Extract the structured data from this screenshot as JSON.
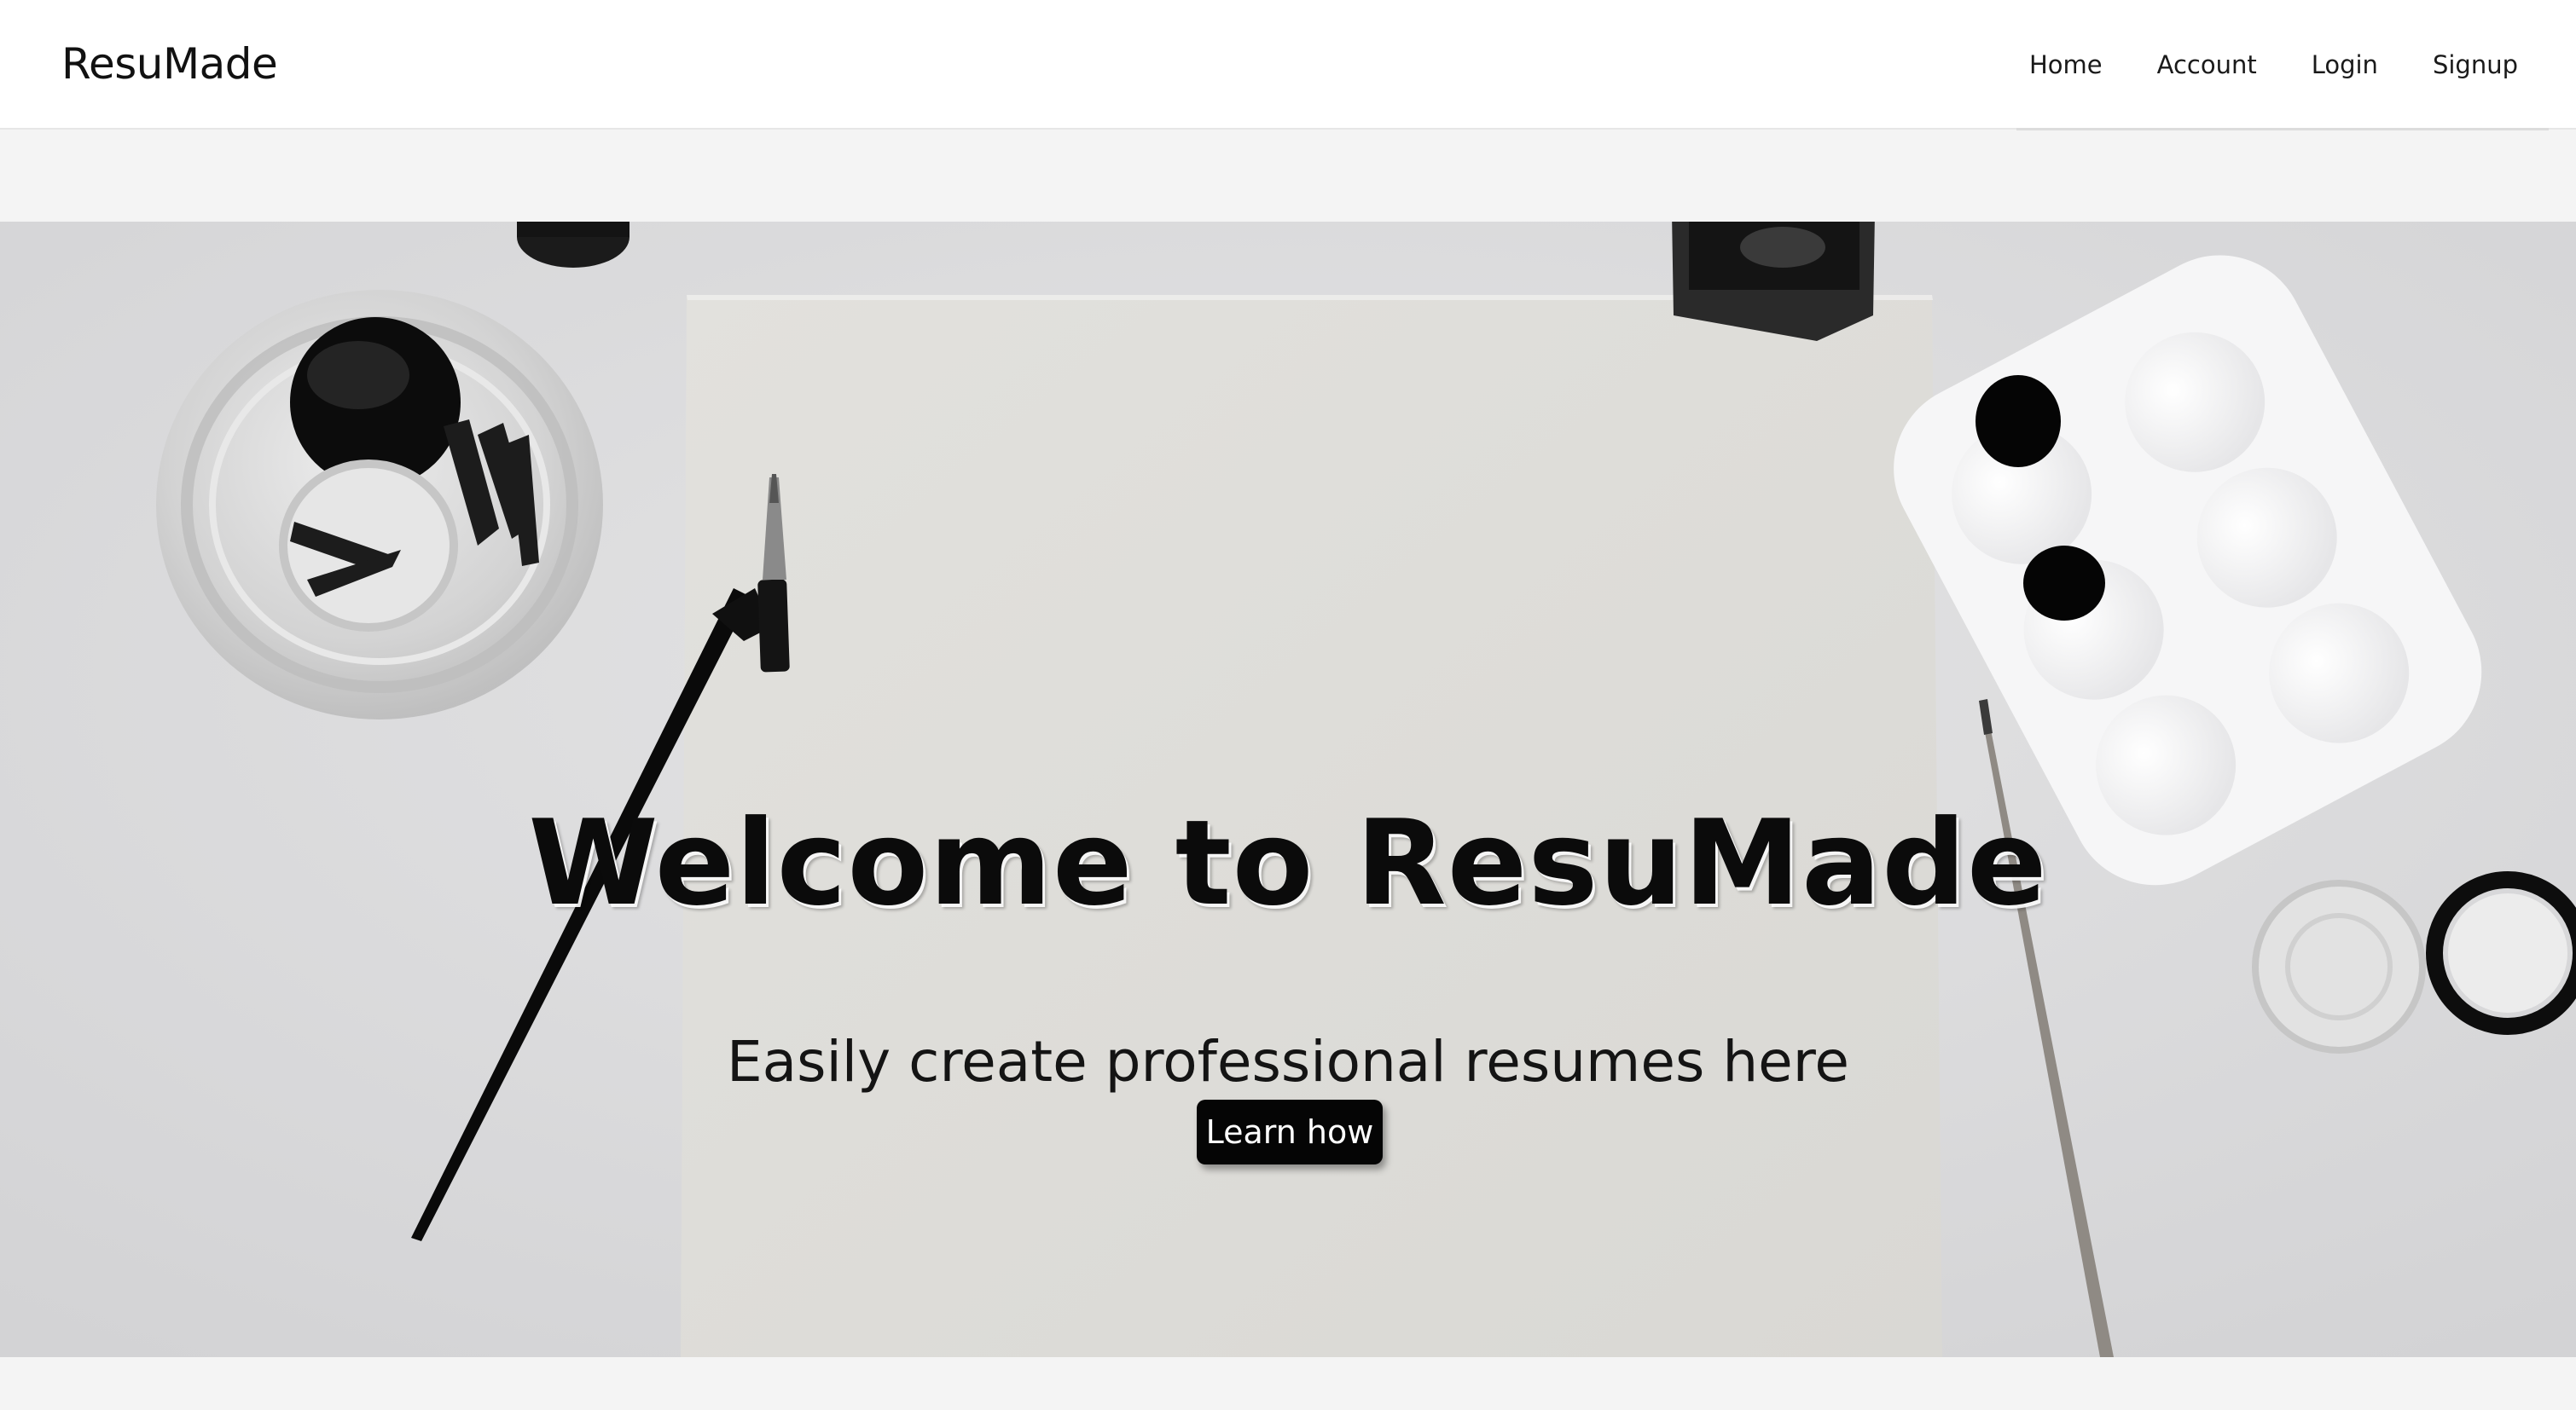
{
  "header": {
    "brand": "ResuMade",
    "nav": [
      {
        "label": "Home"
      },
      {
        "label": "Account"
      },
      {
        "label": "Login"
      },
      {
        "label": "Signup"
      }
    ]
  },
  "hero": {
    "title": "Welcome to ResuMade",
    "subtitle": "Easily create professional resumes here",
    "cta_label": "Learn how",
    "background_image": "desk with paper, calligraphy pen, ink jars and paint palette"
  },
  "colors": {
    "header_bg": "#ffffff",
    "page_bg": "#f4f4f4",
    "hero_bg": "#d8d8da",
    "button_bg": "#050505",
    "button_text": "#ffffff",
    "text": "#111111"
  }
}
